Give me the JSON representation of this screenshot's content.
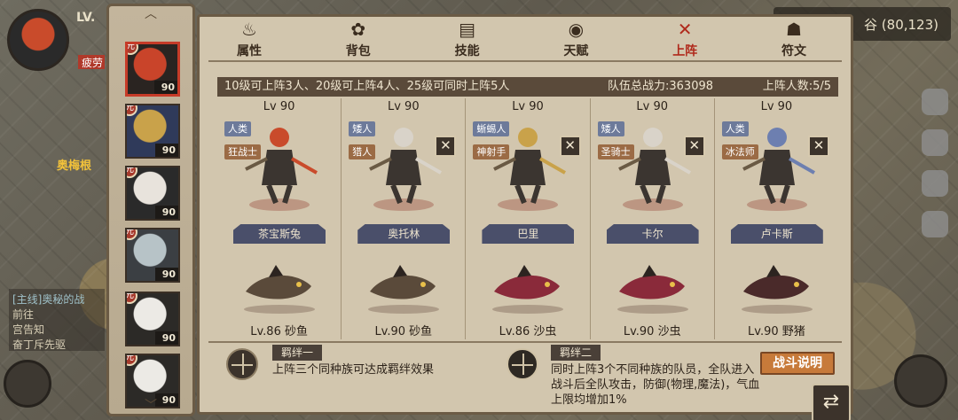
{
  "hud": {
    "level": "LV.",
    "location_text": "谷 (80,123)",
    "npc_name": "奥梅根",
    "quest_lines": [
      "[主线]奥秘的战",
      "前往",
      "宫告知",
      "奋丁斥先驱"
    ],
    "hp_text": "疲劳"
  },
  "tabs": [
    {
      "label": "属性",
      "icon": "flame-icon"
    },
    {
      "label": "背包",
      "icon": "bag-icon"
    },
    {
      "label": "技能",
      "icon": "book-icon"
    },
    {
      "label": "天赋",
      "icon": "eye-icon"
    },
    {
      "label": "上阵",
      "icon": "crossed-swords-icon",
      "active": true
    },
    {
      "label": "符文",
      "icon": "rune-icon"
    }
  ],
  "info": {
    "rule": "10级可上阵3人、20级可上阵4人、25级可同时上阵5人",
    "power_label": "队伍总战力:",
    "power_value": "363098",
    "count_label": "上阵人数:",
    "count_value": "5/5"
  },
  "heroes_column": [
    {
      "level": "90",
      "badge": "元",
      "selected": true,
      "colors": [
        "#c9442a",
        "#2a2421"
      ]
    },
    {
      "level": "90",
      "badge": "元",
      "colors": [
        "#c9a24a",
        "#2f3a5a"
      ]
    },
    {
      "level": "90",
      "badge": "元",
      "colors": [
        "#e8e3dc",
        "#2a2a2a"
      ]
    },
    {
      "level": "90",
      "badge": "元",
      "colors": [
        "#b7c3c7",
        "#3b3f43"
      ]
    },
    {
      "level": "90",
      "badge": "元",
      "colors": [
        "#eceae5",
        "#2c2a27"
      ]
    },
    {
      "level": "90",
      "badge": "元",
      "colors": [
        "#eceae5",
        "#2c2a27"
      ]
    }
  ],
  "lineup": [
    {
      "lv": "Lv 90",
      "race": "人类",
      "class": "狂战士",
      "name": "茶宝斯兔",
      "removable": false,
      "pet": "Lv.86 砂鱼",
      "hero_color": "#c94b2b",
      "pet_color": "#5a4a3a"
    },
    {
      "lv": "Lv 90",
      "race": "矮人",
      "class": "猎人",
      "name": "奥托林",
      "removable": true,
      "pet": "Lv.90 砂鱼",
      "hero_color": "#d9d3c9",
      "pet_color": "#5a4a3a"
    },
    {
      "lv": "Lv 90",
      "race": "蜥蜴人",
      "class": "神射手",
      "name": "巴里",
      "removable": true,
      "pet": "Lv.86 沙虫",
      "hero_color": "#c9a24a",
      "pet_color": "#8a2a3a"
    },
    {
      "lv": "Lv 90",
      "race": "矮人",
      "class": "圣骑士",
      "name": "卡尔",
      "removable": true,
      "pet": "Lv.90 沙虫",
      "hero_color": "#d9d3c9",
      "pet_color": "#8a2a3a"
    },
    {
      "lv": "Lv 90",
      "race": "人类",
      "class": "冰法师",
      "name": "卢卡斯",
      "removable": true,
      "pet": "Lv.90 野猪",
      "hero_color": "#6d7fb0",
      "pet_color": "#4a2a2a"
    }
  ],
  "bonds": {
    "bond1": {
      "title": "羁绊一",
      "desc": "上阵三个同种族可达成羁绊效果"
    },
    "bond2": {
      "title": "羁绊二",
      "desc_lines": [
        "同时上阵3个不同种族的队员，全队进入",
        "战斗后全队攻击，防御(物理,魔法)，气血",
        "上限均增加1%"
      ]
    },
    "battle_btn": "战斗说明"
  }
}
